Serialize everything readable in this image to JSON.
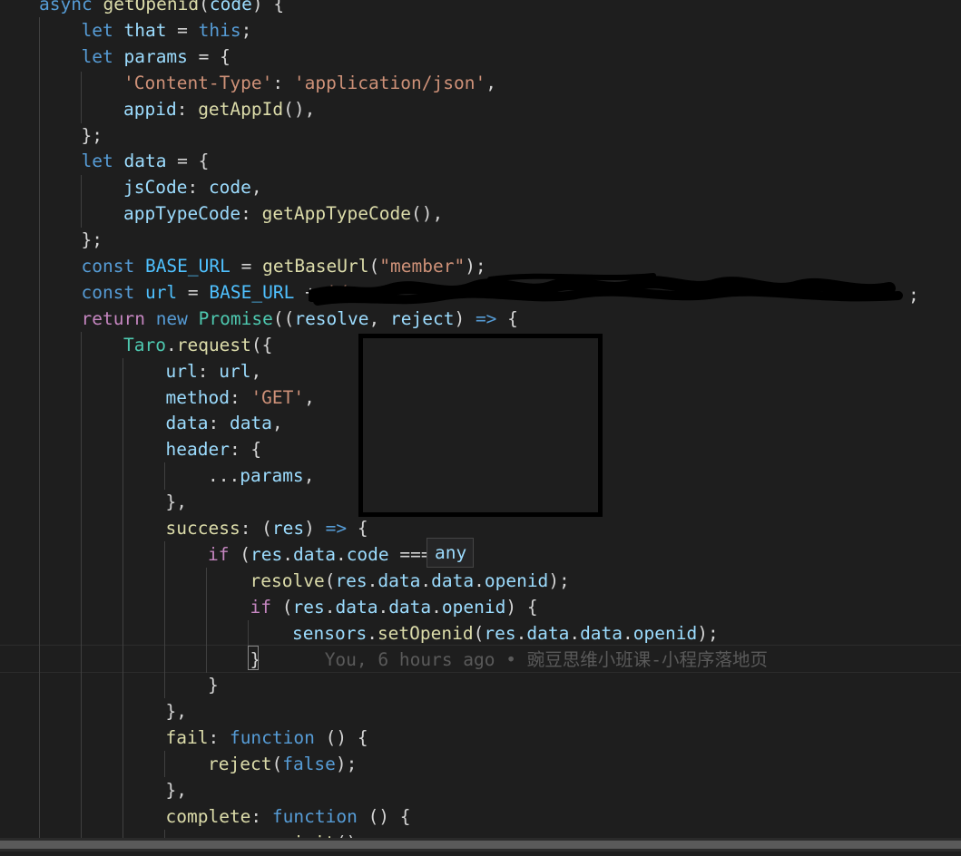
{
  "editor": {
    "lines": [
      [
        {
          "t": "async ",
          "c": "kw"
        },
        {
          "t": "getOpenid",
          "c": "fn"
        },
        {
          "t": "(",
          "c": "pun"
        },
        {
          "t": "code",
          "c": "var"
        },
        {
          "t": ") {",
          "c": "pun"
        }
      ],
      [
        {
          "t": "let ",
          "c": "kw"
        },
        {
          "t": "that",
          "c": "var"
        },
        {
          "t": " = ",
          "c": "pun"
        },
        {
          "t": "this",
          "c": "kw"
        },
        {
          "t": ";",
          "c": "pun"
        }
      ],
      [
        {
          "t": "let ",
          "c": "kw"
        },
        {
          "t": "params",
          "c": "var"
        },
        {
          "t": " = {",
          "c": "pun"
        }
      ],
      [
        {
          "t": "'Content-Type'",
          "c": "str"
        },
        {
          "t": ": ",
          "c": "pun"
        },
        {
          "t": "'application/json'",
          "c": "str"
        },
        {
          "t": ",",
          "c": "pun"
        }
      ],
      [
        {
          "t": "appid",
          "c": "var"
        },
        {
          "t": ": ",
          "c": "pun"
        },
        {
          "t": "getAppId",
          "c": "fn"
        },
        {
          "t": "(),",
          "c": "pun"
        }
      ],
      [
        {
          "t": "};",
          "c": "pun"
        }
      ],
      [
        {
          "t": "let ",
          "c": "kw"
        },
        {
          "t": "data",
          "c": "var"
        },
        {
          "t": " = {",
          "c": "pun"
        }
      ],
      [
        {
          "t": "jsCode",
          "c": "var"
        },
        {
          "t": ": ",
          "c": "pun"
        },
        {
          "t": "code",
          "c": "var"
        },
        {
          "t": ",",
          "c": "pun"
        }
      ],
      [
        {
          "t": "appTypeCode",
          "c": "var"
        },
        {
          "t": ": ",
          "c": "pun"
        },
        {
          "t": "getAppTypeCode",
          "c": "fn"
        },
        {
          "t": "(),",
          "c": "pun"
        }
      ],
      [
        {
          "t": "};",
          "c": "pun"
        }
      ],
      [
        {
          "t": "const ",
          "c": "kw"
        },
        {
          "t": "BASE_URL",
          "c": "const"
        },
        {
          "t": " = ",
          "c": "pun"
        },
        {
          "t": "getBaseUrl",
          "c": "fn"
        },
        {
          "t": "(",
          "c": "pun"
        },
        {
          "t": "\"member\"",
          "c": "str"
        },
        {
          "t": ");",
          "c": "pun"
        }
      ],
      [
        {
          "t": "const ",
          "c": "kw"
        },
        {
          "t": "url",
          "c": "const"
        },
        {
          "t": " = ",
          "c": "pun"
        },
        {
          "t": "BASE_URL",
          "c": "const"
        },
        {
          "t": " + ",
          "c": "pun"
        },
        {
          "t": "'/",
          "c": "str"
        }
      ],
      [
        {
          "t": "return ",
          "c": "ctl"
        },
        {
          "t": "new ",
          "c": "kw"
        },
        {
          "t": "Promise",
          "c": "cls"
        },
        {
          "t": "((",
          "c": "pun"
        },
        {
          "t": "resolve",
          "c": "var"
        },
        {
          "t": ", ",
          "c": "pun"
        },
        {
          "t": "reject",
          "c": "var"
        },
        {
          "t": ") ",
          "c": "pun"
        },
        {
          "t": "=>",
          "c": "kw"
        },
        {
          "t": " {",
          "c": "pun"
        }
      ],
      [
        {
          "t": "Taro",
          "c": "cls"
        },
        {
          "t": ".",
          "c": "pun"
        },
        {
          "t": "request",
          "c": "fn"
        },
        {
          "t": "({",
          "c": "pun"
        }
      ],
      [
        {
          "t": "url",
          "c": "var"
        },
        {
          "t": ": ",
          "c": "pun"
        },
        {
          "t": "url",
          "c": "var"
        },
        {
          "t": ",",
          "c": "pun"
        }
      ],
      [
        {
          "t": "method",
          "c": "var"
        },
        {
          "t": ": ",
          "c": "pun"
        },
        {
          "t": "'GET'",
          "c": "str"
        },
        {
          "t": ",",
          "c": "pun"
        }
      ],
      [
        {
          "t": "data",
          "c": "var"
        },
        {
          "t": ": ",
          "c": "pun"
        },
        {
          "t": "data",
          "c": "var"
        },
        {
          "t": ",",
          "c": "pun"
        }
      ],
      [
        {
          "t": "header",
          "c": "var"
        },
        {
          "t": ": {",
          "c": "pun"
        }
      ],
      [
        {
          "t": "...",
          "c": "pun"
        },
        {
          "t": "params",
          "c": "var"
        },
        {
          "t": ",",
          "c": "pun"
        }
      ],
      [
        {
          "t": "},",
          "c": "pun"
        }
      ],
      [
        {
          "t": "success",
          "c": "fn"
        },
        {
          "t": ": (",
          "c": "pun"
        },
        {
          "t": "res",
          "c": "var"
        },
        {
          "t": ") ",
          "c": "pun"
        },
        {
          "t": "=>",
          "c": "kw"
        },
        {
          "t": " {",
          "c": "pun"
        }
      ],
      [
        {
          "t": "if ",
          "c": "ctl"
        },
        {
          "t": "(",
          "c": "pun"
        },
        {
          "t": "res",
          "c": "var"
        },
        {
          "t": ".",
          "c": "pun"
        },
        {
          "t": "data",
          "c": "var"
        },
        {
          "t": ".",
          "c": "pun"
        },
        {
          "t": "code",
          "c": "var"
        },
        {
          "t": " ===",
          "c": "pun"
        }
      ],
      [
        {
          "t": "resolve",
          "c": "fn"
        },
        {
          "t": "(",
          "c": "pun"
        },
        {
          "t": "res",
          "c": "var"
        },
        {
          "t": ".",
          "c": "pun"
        },
        {
          "t": "data",
          "c": "var"
        },
        {
          "t": ".",
          "c": "pun"
        },
        {
          "t": "data",
          "c": "var"
        },
        {
          "t": ".",
          "c": "pun"
        },
        {
          "t": "openid",
          "c": "var"
        },
        {
          "t": ");",
          "c": "pun"
        }
      ],
      [
        {
          "t": "if ",
          "c": "ctl"
        },
        {
          "t": "(",
          "c": "pun"
        },
        {
          "t": "res",
          "c": "var"
        },
        {
          "t": ".",
          "c": "pun"
        },
        {
          "t": "data",
          "c": "var"
        },
        {
          "t": ".",
          "c": "pun"
        },
        {
          "t": "data",
          "c": "var"
        },
        {
          "t": ".",
          "c": "pun"
        },
        {
          "t": "openid",
          "c": "var"
        },
        {
          "t": ") {",
          "c": "pun"
        }
      ],
      [
        {
          "t": "sensors",
          "c": "var"
        },
        {
          "t": ".",
          "c": "pun"
        },
        {
          "t": "setOpenid",
          "c": "fn"
        },
        {
          "t": "(",
          "c": "pun"
        },
        {
          "t": "res",
          "c": "var"
        },
        {
          "t": ".",
          "c": "pun"
        },
        {
          "t": "data",
          "c": "var"
        },
        {
          "t": ".",
          "c": "pun"
        },
        {
          "t": "data",
          "c": "var"
        },
        {
          "t": ".",
          "c": "pun"
        },
        {
          "t": "openid",
          "c": "var"
        },
        {
          "t": ");",
          "c": "pun"
        }
      ],
      [
        {
          "t": "}",
          "c": "pun"
        },
        {
          "t": "      You, 6 hours ago • 豌豆思维小班课-小程序落地页",
          "c": "blame"
        }
      ],
      [
        {
          "t": "}",
          "c": "pun"
        }
      ],
      [
        {
          "t": "},",
          "c": "pun"
        }
      ],
      [
        {
          "t": "fail",
          "c": "fn"
        },
        {
          "t": ": ",
          "c": "pun"
        },
        {
          "t": "function",
          "c": "kw"
        },
        {
          "t": " () {",
          "c": "pun"
        }
      ],
      [
        {
          "t": "reject",
          "c": "fn"
        },
        {
          "t": "(",
          "c": "pun"
        },
        {
          "t": "false",
          "c": "kw"
        },
        {
          "t": ");",
          "c": "pun"
        }
      ],
      [
        {
          "t": "},",
          "c": "pun"
        }
      ],
      [
        {
          "t": "complete",
          "c": "fn"
        },
        {
          "t": ": ",
          "c": "pun"
        },
        {
          "t": "function",
          "c": "kw"
        },
        {
          "t": " () {",
          "c": "pun"
        }
      ],
      [
        {
          "t": "sensors",
          "c": "var"
        },
        {
          "t": ".",
          "c": "pun"
        },
        {
          "t": "init",
          "c": "fn"
        },
        {
          "t": "();",
          "c": "pun"
        }
      ]
    ],
    "trailing_semicolon": ";"
  },
  "hover": {
    "type_hint": "any"
  },
  "colors": {
    "background": "#1e1e1e",
    "keyword": "#569cd6",
    "control": "#c586c0",
    "variable": "#9cdcfe",
    "constant": "#4fc1ff",
    "function": "#dcdcaa",
    "class": "#4ec9b0",
    "string": "#ce9178",
    "blame": "#5a5a5a"
  }
}
